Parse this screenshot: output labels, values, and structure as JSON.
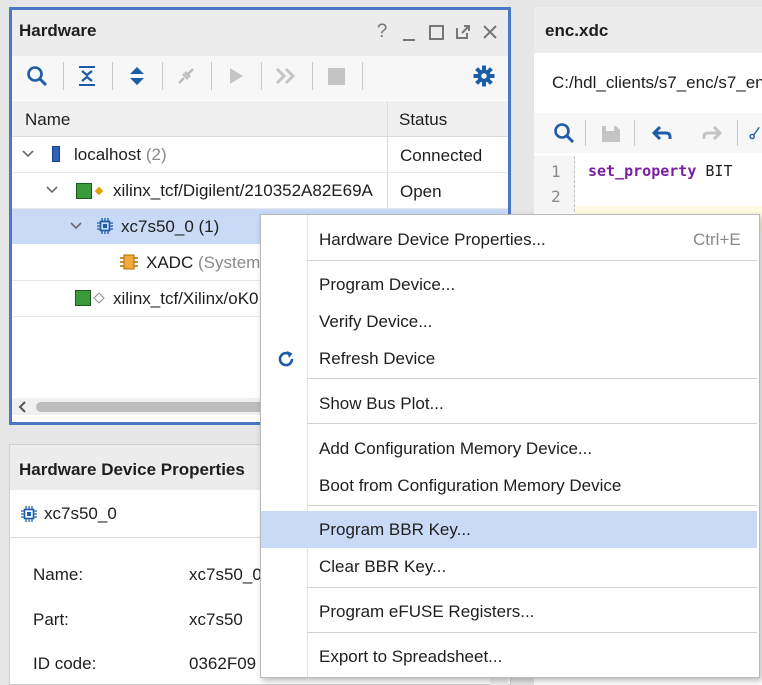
{
  "hardware_panel": {
    "title": "Hardware",
    "header_icons": [
      "help-icon",
      "minimize-icon",
      "maximize-icon",
      "float-icon",
      "close-icon"
    ],
    "toolbar_icons": [
      "search-icon",
      "collapse-all-icon",
      "expand-all-icon",
      "disconnect-icon",
      "run-icon",
      "fast-forward-icon",
      "stop-icon",
      "gear-icon"
    ],
    "columns": {
      "name": "Name",
      "status": "Status"
    },
    "tree": {
      "localhost": {
        "label": "localhost",
        "count": "(2)",
        "status": "Connected"
      },
      "digilent": {
        "label": "xilinx_tcf/Digilent/210352A82E69A",
        "status": "Open"
      },
      "device": {
        "label": "xc7s50_0 (1)"
      },
      "xadc": {
        "label": "XADC",
        "suffix": "(System"
      },
      "xilinx": {
        "label": "xilinx_tcf/Xilinx/oK0"
      }
    }
  },
  "editor_panel": {
    "tab": "enc.xdc",
    "path": "C:/hdl_clients/s7_enc/s7_en",
    "line_numbers": [
      "1",
      "2"
    ],
    "code_keyword": "set_property",
    "code_rest": " BIT"
  },
  "properties_panel": {
    "title": "Hardware Device Properties",
    "device": "xc7s50_0",
    "fields": [
      {
        "label": "Name:",
        "value": "xc7s50_0"
      },
      {
        "label": "Part:",
        "value": "xc7s50"
      },
      {
        "label": "ID code:",
        "value": "0362F09"
      }
    ]
  },
  "context_menu": {
    "items": [
      {
        "label": "Hardware Device Properties...",
        "shortcut": "Ctrl+E"
      },
      {
        "label": "Program Device..."
      },
      {
        "label": "Verify Device..."
      },
      {
        "label": "Refresh Device",
        "icon": "refresh-icon"
      },
      {
        "label": "Show Bus Plot..."
      },
      {
        "label": "Add Configuration Memory Device..."
      },
      {
        "label": "Boot from Configuration Memory Device"
      },
      {
        "label": "Program BBR Key...",
        "highlighted": true
      },
      {
        "label": "Clear BBR Key..."
      },
      {
        "label": "Program eFUSE Registers..."
      },
      {
        "label": "Export to Spreadsheet..."
      }
    ]
  },
  "colors": {
    "accent": "#4a78c4",
    "selection": "#c8daf6",
    "keyword": "#7a1fa2",
    "icon_blue": "#1d5da8"
  }
}
